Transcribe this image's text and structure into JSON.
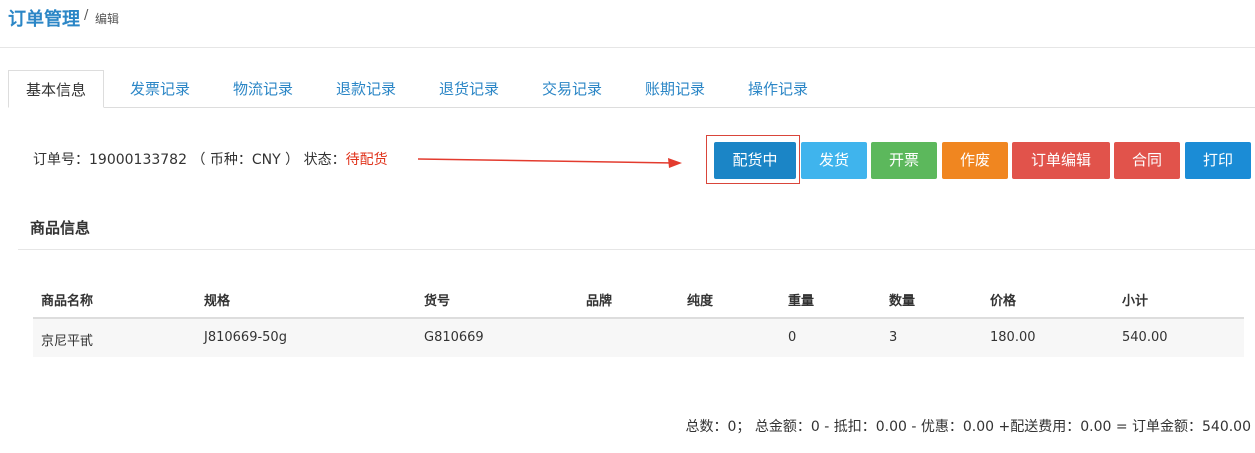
{
  "header": {
    "title": "订单管理",
    "separator": "/",
    "subtitle": "编辑"
  },
  "tabs": [
    {
      "label": "基本信息",
      "active": true
    },
    {
      "label": "发票记录"
    },
    {
      "label": "物流记录"
    },
    {
      "label": "退款记录"
    },
    {
      "label": "退货记录"
    },
    {
      "label": "交易记录"
    },
    {
      "label": "账期记录"
    },
    {
      "label": "操作记录"
    }
  ],
  "order": {
    "label_no": "订单号：",
    "no": "19000133782",
    "currency_text": "（ 币种：CNY ）",
    "label_status": "状态：",
    "status": "待配货"
  },
  "actions": [
    {
      "label": "配货中",
      "color": "#1b85c6"
    },
    {
      "label": "发货",
      "color": "#3fb4ed"
    },
    {
      "label": "开票",
      "color": "#5cb85c"
    },
    {
      "label": "作废",
      "color": "#f08620"
    },
    {
      "label": "订单编辑",
      "color": "#e1534b"
    },
    {
      "label": "合同",
      "color": "#e1534b"
    },
    {
      "label": "打印",
      "color": "#1b8cd6"
    }
  ],
  "section": {
    "title": "商品信息"
  },
  "table": {
    "columns": [
      "商品名称",
      "规格",
      "货号",
      "品牌",
      "纯度",
      "重量",
      "数量",
      "价格",
      "小计"
    ],
    "rows": [
      [
        "京尼平甙",
        "J810669-50g",
        "G810669",
        "",
        "",
        "0",
        "3",
        "180.00",
        "540.00"
      ]
    ]
  },
  "summary": "总数：0； 总金额：0 - 抵扣：0.00 - 优惠：0.00 +配送费用：0.00 = 订单金额：540.00",
  "colors": {
    "accent": "#2b86c6",
    "status": "#e0331b",
    "arrow": "#e33b2e"
  }
}
